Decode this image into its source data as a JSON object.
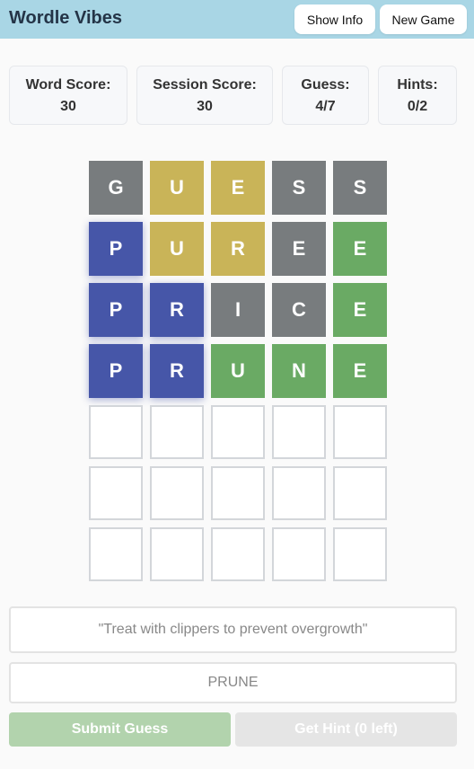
{
  "header": {
    "title": "Wordle Vibes",
    "show_info_label": "Show Info",
    "new_game_label": "New Game"
  },
  "stats": {
    "word_score": {
      "label": "Word Score:",
      "value": "30"
    },
    "session_score": {
      "label": "Session Score:",
      "value": "30"
    },
    "guess": {
      "label": "Guess:",
      "value": "4/7"
    },
    "hints": {
      "label": "Hints:",
      "value": "0/2"
    }
  },
  "colors": {
    "gray": "#787c7e",
    "yellow": "#c9b458",
    "green": "#6aaa64",
    "blue": "#4656a8",
    "header_bg": "#a9d6e5"
  },
  "board": {
    "rows": [
      [
        {
          "letter": "G",
          "state": "gray"
        },
        {
          "letter": "U",
          "state": "yellow"
        },
        {
          "letter": "E",
          "state": "yellow"
        },
        {
          "letter": "S",
          "state": "gray"
        },
        {
          "letter": "S",
          "state": "gray"
        }
      ],
      [
        {
          "letter": "P",
          "state": "blue"
        },
        {
          "letter": "U",
          "state": "yellow"
        },
        {
          "letter": "R",
          "state": "yellow"
        },
        {
          "letter": "E",
          "state": "gray"
        },
        {
          "letter": "E",
          "state": "green"
        }
      ],
      [
        {
          "letter": "P",
          "state": "blue"
        },
        {
          "letter": "R",
          "state": "blue"
        },
        {
          "letter": "I",
          "state": "gray"
        },
        {
          "letter": "C",
          "state": "gray"
        },
        {
          "letter": "E",
          "state": "green"
        }
      ],
      [
        {
          "letter": "P",
          "state": "blue"
        },
        {
          "letter": "R",
          "state": "blue"
        },
        {
          "letter": "U",
          "state": "green"
        },
        {
          "letter": "N",
          "state": "green"
        },
        {
          "letter": "E",
          "state": "green"
        }
      ],
      [
        {
          "letter": "",
          "state": "empty"
        },
        {
          "letter": "",
          "state": "empty"
        },
        {
          "letter": "",
          "state": "empty"
        },
        {
          "letter": "",
          "state": "empty"
        },
        {
          "letter": "",
          "state": "empty"
        }
      ],
      [
        {
          "letter": "",
          "state": "empty"
        },
        {
          "letter": "",
          "state": "empty"
        },
        {
          "letter": "",
          "state": "empty"
        },
        {
          "letter": "",
          "state": "empty"
        },
        {
          "letter": "",
          "state": "empty"
        }
      ],
      [
        {
          "letter": "",
          "state": "empty"
        },
        {
          "letter": "",
          "state": "empty"
        },
        {
          "letter": "",
          "state": "empty"
        },
        {
          "letter": "",
          "state": "empty"
        },
        {
          "letter": "",
          "state": "empty"
        }
      ]
    ]
  },
  "clue": {
    "text": "\"Treat with clippers to prevent overgrowth\""
  },
  "input": {
    "value": "PRUNE",
    "placeholder": "PRUNE"
  },
  "actions": {
    "submit_label": "Submit Guess",
    "hint_label": "Get Hint (0 left)"
  }
}
